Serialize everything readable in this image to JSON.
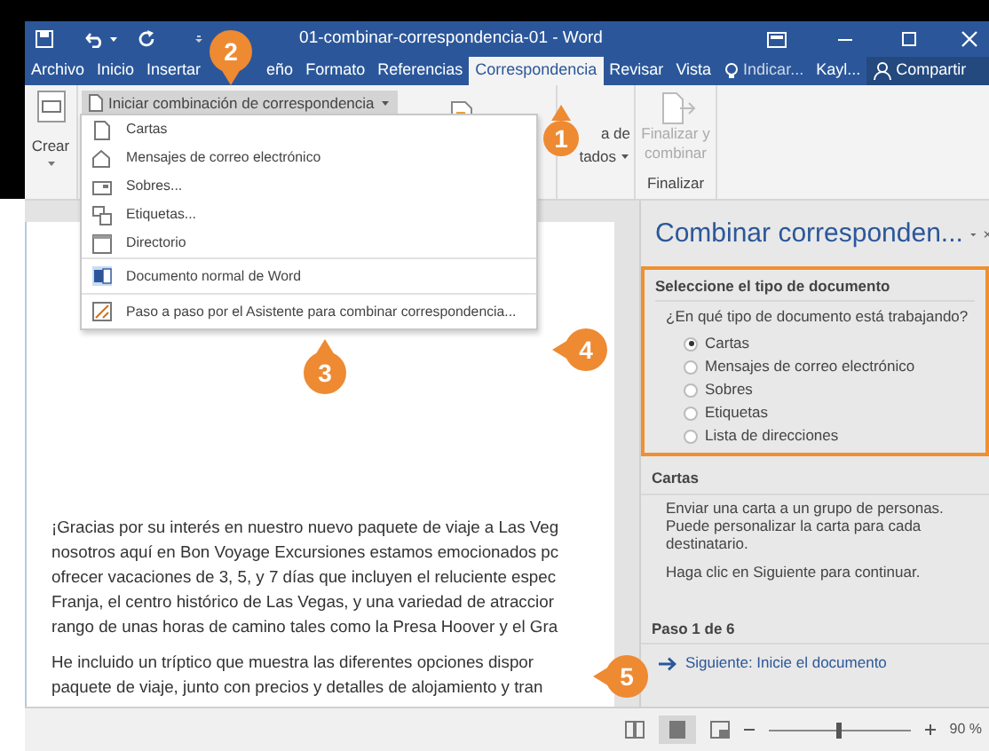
{
  "window": {
    "title": "01-combinar-correspondencia-01 - Word"
  },
  "tabs": [
    {
      "label": "Archivo",
      "selected": false
    },
    {
      "label": "Inicio",
      "selected": false
    },
    {
      "label": "Insertar",
      "selected": false
    },
    {
      "label": "eño",
      "selected": false
    },
    {
      "label": "Formato",
      "selected": false
    },
    {
      "label": "Referencias",
      "selected": false
    },
    {
      "label": "Correspondencia",
      "selected": true
    },
    {
      "label": "Revisar",
      "selected": false
    },
    {
      "label": "Vista",
      "selected": false
    }
  ],
  "tell_me": "Indicar...",
  "user": "Kayl...",
  "share": "Compartir",
  "ribbon": {
    "create": "Crear",
    "start_merge": "Iniciar combinación de correspondencia",
    "partial_label_1": "a de",
    "partial_label_2": "tados",
    "finish": {
      "label": "Finalizar y combinar",
      "disabled": true
    },
    "finish_group": "Finalizar"
  },
  "merge_menu": [
    {
      "label": "Cartas",
      "kind": "item"
    },
    {
      "label": "Mensajes de correo electrónico",
      "kind": "item"
    },
    {
      "label": "Sobres...",
      "kind": "item"
    },
    {
      "label": "Etiquetas...",
      "kind": "item"
    },
    {
      "label": "Directorio",
      "kind": "item"
    },
    {
      "label": "Documento normal de Word",
      "kind": "section"
    },
    {
      "label": "Paso a paso por el Asistente para combinar correspondencia...",
      "kind": "section"
    }
  ],
  "task_pane": {
    "title": "Combinar corresponden...",
    "section_title": "Seleccione el tipo de documento",
    "question": "¿En qué tipo de documento está trabajando?",
    "options": [
      {
        "label": "Cartas",
        "selected": true
      },
      {
        "label": "Mensajes de correo electrónico",
        "selected": false
      },
      {
        "label": "Sobres",
        "selected": false
      },
      {
        "label": "Etiquetas",
        "selected": false
      },
      {
        "label": "Lista de direcciones",
        "selected": false
      }
    ],
    "info_title": "Cartas",
    "info_text": "Enviar una carta a un grupo de personas. Puede personalizar la carta para cada destinatario.",
    "info_hint": "Haga clic en Siguiente para continuar.",
    "step": "Paso 1 de 6",
    "next_link": "Siguiente: Inicie el documento"
  },
  "document": {
    "lines": [
      "¡Gracias por su interés en nuestro nuevo paquete de viaje a Las Veg",
      "nosotros aquí en Bon Voyage Excursiones estamos emocionados pc",
      "ofrecer vacaciones de 3, 5, y 7 días que incluyen el reluciente espec",
      "Franja, el centro histórico de Las Vegas, y una variedad de atraccior",
      "rango de unas horas de camino tales como la Presa Hoover y el Gra"
    ],
    "lines_2": [
      "He incluido un tríptico que muestra las diferentes opciones dispor",
      "paquete de viaje, junto con precios y detalles de alojamiento y tran"
    ]
  },
  "status_bar": {
    "zoom": "90 %",
    "zoom_slider": {
      "level": 0.5
    }
  },
  "callouts": [
    "1",
    "2",
    "3",
    "4",
    "5"
  ]
}
